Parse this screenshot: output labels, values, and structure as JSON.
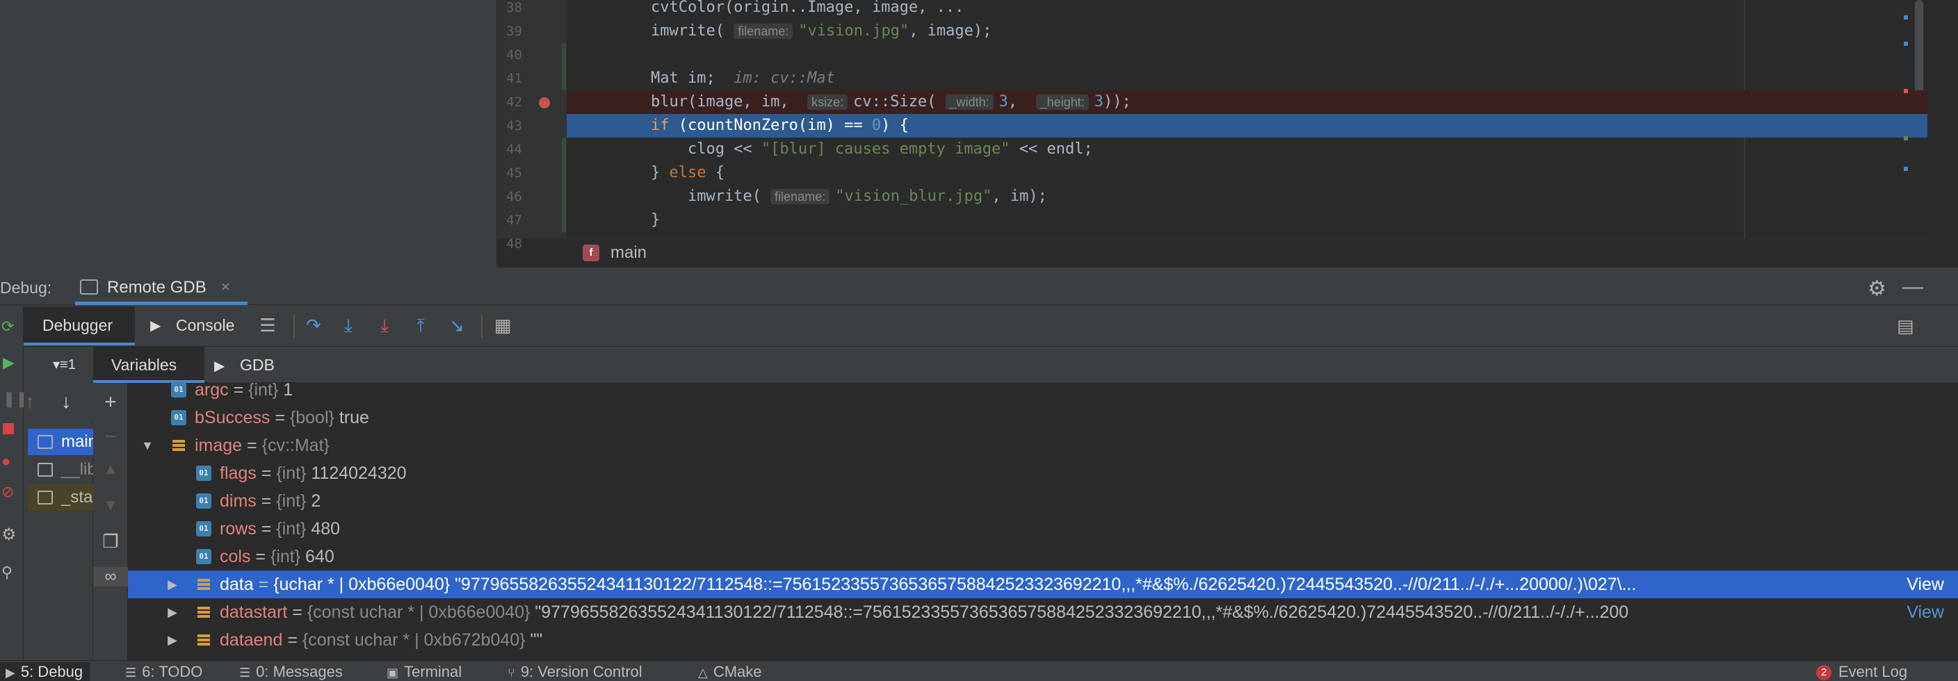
{
  "editor": {
    "lines": [
      {
        "num": "38",
        "parts": [
          [
            "plain",
            "    cvtColor(origin..Image, image, ..."
          ]
        ]
      },
      {
        "num": "39",
        "parts": [
          [
            "plain",
            "    imwrite( "
          ],
          [
            "hint",
            "filename:"
          ],
          [
            "str",
            "\"vision.jpg\""
          ],
          [
            "plain",
            ", image);"
          ]
        ]
      },
      {
        "num": "40",
        "parts": []
      },
      {
        "num": "41",
        "parts": [
          [
            "plain",
            "    Mat im;  "
          ],
          [
            "var",
            "im: cv::Mat"
          ]
        ]
      },
      {
        "num": "42",
        "parts": [
          [
            "plain",
            "    blur(image, im,  "
          ],
          [
            "hint",
            "ksize:"
          ],
          [
            "plain",
            "cv::Size( "
          ],
          [
            "hint",
            "_width:"
          ],
          [
            "num",
            "3"
          ],
          [
            "plain",
            ",  "
          ],
          [
            "hint",
            "_height:"
          ],
          [
            "num",
            "3"
          ],
          [
            "plain",
            "));"
          ]
        ]
      },
      {
        "num": "43",
        "parts": [
          [
            "kw",
            "    if"
          ],
          [
            "plain",
            " (countNonZero(im) == "
          ],
          [
            "num",
            "0"
          ],
          [
            "plain",
            ") {"
          ]
        ]
      },
      {
        "num": "44",
        "parts": [
          [
            "plain",
            "        clog << "
          ],
          [
            "str",
            "\"[blur] causes empty image\""
          ],
          [
            "plain",
            " << endl;"
          ]
        ]
      },
      {
        "num": "45",
        "parts": [
          [
            "plain",
            "    } "
          ],
          [
            "kw",
            "else"
          ],
          [
            "plain",
            " {"
          ]
        ]
      },
      {
        "num": "46",
        "parts": [
          [
            "plain",
            "        imwrite( "
          ],
          [
            "hint",
            "filename:"
          ],
          [
            "str",
            "\"vision_blur.jpg\""
          ],
          [
            "plain",
            ", im);"
          ]
        ]
      },
      {
        "num": "47",
        "parts": [
          [
            "plain",
            "    }"
          ]
        ]
      },
      {
        "num": "48",
        "parts": []
      }
    ],
    "breakpoint_line": "42",
    "execution_line": "43",
    "breadcrumb_icon": "f",
    "breadcrumb": "main"
  },
  "debug": {
    "title": "Debug:",
    "session_tab": "Remote GDB",
    "close_glyph": "×",
    "settings_icon": "gear-icon",
    "minimize_icon": "minimize-icon"
  },
  "toolbar": {
    "debugger_tab": "Debugger",
    "console_tab": "Console",
    "buttons": [
      {
        "name": "layout-menu-button",
        "glyph": "☰",
        "color": "#afb1b3"
      },
      {
        "name": "step-over-button",
        "glyph": "↷",
        "color": "#4a9be0"
      },
      {
        "name": "step-into-button",
        "glyph": "⤓",
        "color": "#4a9be0"
      },
      {
        "name": "force-step-into-button",
        "glyph": "⤓",
        "color": "#e05555"
      },
      {
        "name": "step-out-button",
        "glyph": "⤒",
        "color": "#4a9be0"
      },
      {
        "name": "run-to-cursor-button",
        "glyph": "↘",
        "color": "#4a9be0"
      },
      {
        "name": "evaluate-expression-button",
        "glyph": "▦",
        "color": "#afb1b3"
      }
    ],
    "restore_layout_icon": "restore-layout-icon"
  },
  "frames": {
    "thread_selector": "▾≡1",
    "items": [
      {
        "label": "main",
        "state": "sel"
      },
      {
        "label": "__libc_start_main",
        "state": "lib"
      },
      {
        "label": "_start",
        "state": "start"
      }
    ]
  },
  "variables": {
    "tab_variables": "Variables",
    "tab_gdb": "GDB",
    "rows": [
      {
        "indent": 0,
        "expand": "",
        "icon": "prim",
        "name": "argc",
        "type": "{int}",
        "value": "1",
        "sel": false,
        "view": ""
      },
      {
        "indent": 0,
        "expand": "",
        "icon": "prim",
        "name": "bSuccess",
        "type": "{bool}",
        "value": "true",
        "sel": false,
        "view": ""
      },
      {
        "indent": 0,
        "expand": "▼",
        "icon": "obj",
        "name": "image",
        "type": "{cv::Mat}",
        "value": "",
        "sel": false,
        "view": ""
      },
      {
        "indent": 1,
        "expand": "",
        "icon": "prim",
        "name": "flags",
        "type": "{int}",
        "value": "1124024320",
        "sel": false,
        "view": ""
      },
      {
        "indent": 1,
        "expand": "",
        "icon": "prim",
        "name": "dims",
        "type": "{int}",
        "value": "2",
        "sel": false,
        "view": ""
      },
      {
        "indent": 1,
        "expand": "",
        "icon": "prim",
        "name": "rows",
        "type": "{int}",
        "value": "480",
        "sel": false,
        "view": ""
      },
      {
        "indent": 1,
        "expand": "",
        "icon": "prim",
        "name": "cols",
        "type": "{int}",
        "value": "640",
        "sel": false,
        "view": ""
      },
      {
        "indent": 1,
        "expand": "▶",
        "icon": "obj",
        "name": "data",
        "type": "{uchar * | 0xb66e0040}",
        "value": "\"977965582635524341130122/7112548::=75615233557365365758842523323692210,,,*#&$%./62625420.)72445543520..-//0/211../-/./+...20000/.)\\027\\...",
        "sel": true,
        "view": "View"
      },
      {
        "indent": 1,
        "expand": "▶",
        "icon": "obj",
        "name": "datastart",
        "type": "{const uchar * | 0xb66e0040}",
        "value": "\"977965582635524341130122/7112548::=75615233557365365758842523323692210,,,*#&$%./62625420.)72445543520..-//0/211../-/./+...200",
        "sel": false,
        "view": "View"
      },
      {
        "indent": 1,
        "expand": "▶",
        "icon": "obj",
        "name": "dataend",
        "type": "{const uchar * | 0xb672b040}",
        "value": "\"\"",
        "sel": false,
        "view": ""
      }
    ]
  },
  "statusbar": {
    "items": [
      {
        "label": "5: Debug",
        "icon": "▶",
        "active": true
      },
      {
        "label": "6: TODO",
        "icon": "☰",
        "active": false
      },
      {
        "label": "0: Messages",
        "icon": "☰",
        "active": false
      },
      {
        "label": "Terminal",
        "icon": "▣",
        "active": false
      },
      {
        "label": "9: Version Control",
        "icon": "⑂",
        "active": false
      },
      {
        "label": "CMake",
        "icon": "△",
        "active": false
      }
    ],
    "event_log": "Event Log",
    "event_count": "2"
  }
}
